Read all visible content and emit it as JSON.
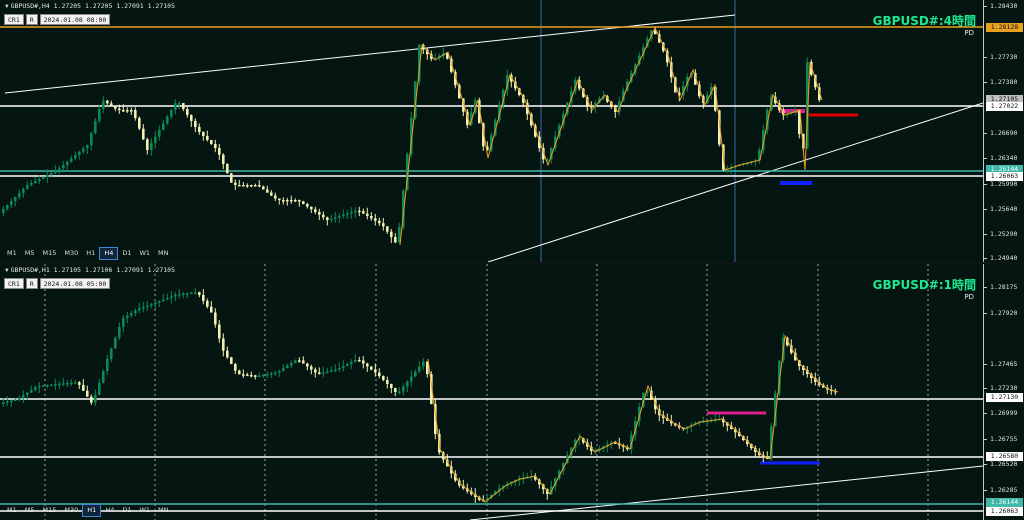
{
  "panels": [
    {
      "symbol_header": "GBPUSD#,H4  1.27205 1.27205 1.27091 1.27105",
      "crosshair_buttons": [
        "CR1",
        "R"
      ],
      "datetime": "2024.01.08 08:00",
      "title": "GBPUSD#:4時間",
      "subtitle": "PD",
      "timeframes": [
        {
          "label": "M1",
          "active": false
        },
        {
          "label": "M5",
          "active": false
        },
        {
          "label": "M15",
          "active": false
        },
        {
          "label": "M30",
          "active": false
        },
        {
          "label": "H1",
          "active": false
        },
        {
          "label": "H4",
          "active": true
        },
        {
          "label": "D1",
          "active": false
        },
        {
          "label": "W1",
          "active": false
        },
        {
          "label": "MN",
          "active": false
        }
      ],
      "price_axis": {
        "ticks": [
          "1.28430",
          "1.27730",
          "1.27380",
          "1.26690",
          "1.26340",
          "1.25990",
          "1.25640",
          "1.25290",
          "1.24940"
        ],
        "badges": [
          {
            "text": "1.28128",
            "price": 1.28128,
            "bg": "#e8a020",
            "fg": "#111111"
          },
          {
            "text": "1.27105",
            "price": 1.27105,
            "bg": "#c0c0c0",
            "fg": "#111111"
          },
          {
            "text": "1.27022",
            "price": 1.27022,
            "bg": "#ffffff",
            "fg": "#111111"
          },
          {
            "text": "1.26144",
            "price": 1.26144,
            "bg": "#3fb8a8",
            "fg": "#ffffff"
          },
          {
            "text": "1.26063",
            "price": 1.26063,
            "bg": "#ffffff",
            "fg": "#111111"
          }
        ]
      }
    },
    {
      "symbol_header": "GBPUSD#,H1  1.27105 1.27106 1.27091 1.27105",
      "crosshair_buttons": [
        "CR1",
        "R"
      ],
      "datetime": "2024.01.08 05:00",
      "title": "GBPUSD#:1時間",
      "subtitle": "PD",
      "timeframes": [
        {
          "label": "M1",
          "active": false
        },
        {
          "label": "M5",
          "active": false
        },
        {
          "label": "M15",
          "active": false
        },
        {
          "label": "M30",
          "active": false
        },
        {
          "label": "H1",
          "active": true
        },
        {
          "label": "H4",
          "active": false
        },
        {
          "label": "D1",
          "active": false
        },
        {
          "label": "W1",
          "active": false
        },
        {
          "label": "MN",
          "active": false
        }
      ],
      "price_axis": {
        "ticks": [
          "1.28175",
          "1.27920",
          "1.27465",
          "1.27230",
          "1.26999",
          "1.26755",
          "1.26520",
          "1.26285"
        ],
        "badges": [
          {
            "text": "1.27130",
            "price": 1.2713,
            "bg": "#ffffff",
            "fg": "#111111"
          },
          {
            "text": "1.26580",
            "price": 1.2658,
            "bg": "#ffffff",
            "fg": "#111111"
          },
          {
            "text": "1.26144",
            "price": 1.26144,
            "bg": "#3fb8a8",
            "fg": "#ffffff"
          },
          {
            "text": "1.26063",
            "price": 1.26063,
            "bg": "#ffffff",
            "fg": "#111111"
          }
        ]
      }
    }
  ],
  "colors": {
    "background": "#051512",
    "bull_candle": "#0b8a55",
    "bear_candle": "#f0f0b0",
    "zigzag": "#e8a020",
    "title_text": "#1de88f",
    "upper_zone": "#e0208c",
    "lower_zone": "#1020ff",
    "resistance_zone": "#e00000",
    "support_line_teal": "#3fb8a8"
  },
  "icons": [
    "dropdown-triangle-icon"
  ]
}
